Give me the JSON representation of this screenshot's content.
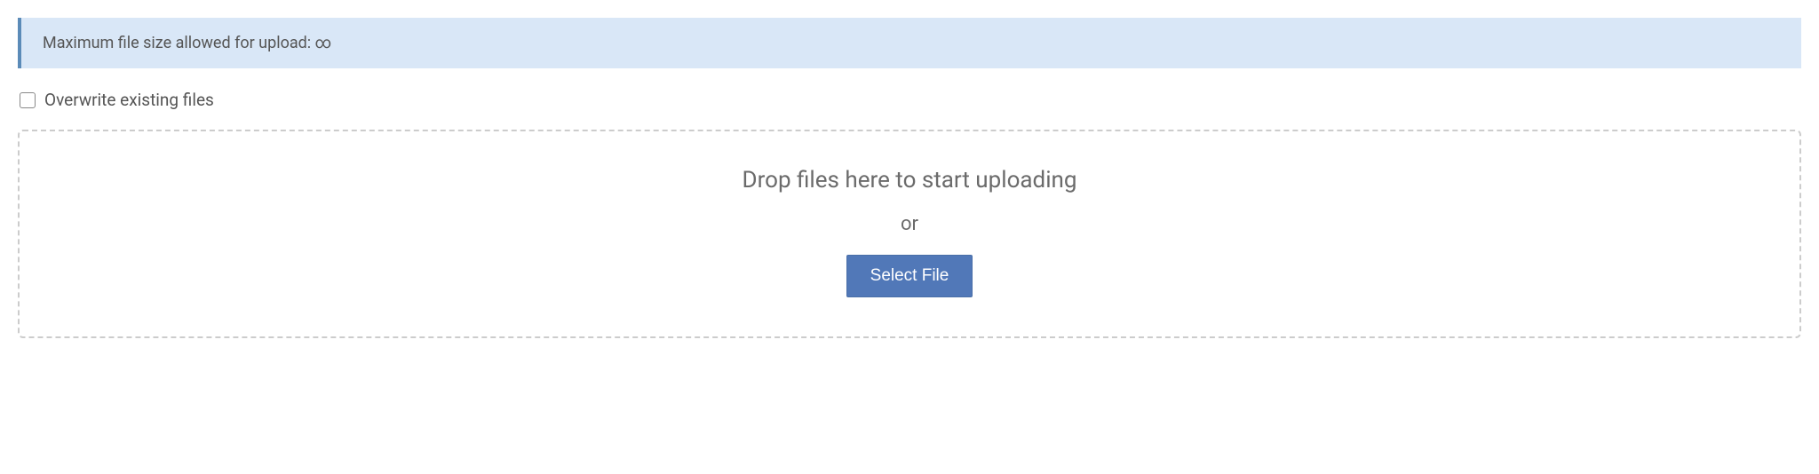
{
  "banner": {
    "message": "Maximum file size allowed for upload: ∞"
  },
  "overwrite": {
    "label": "Overwrite existing files",
    "checked": false
  },
  "dropzone": {
    "title": "Drop files here to start uploading",
    "or": "or",
    "button_label": "Select File"
  }
}
